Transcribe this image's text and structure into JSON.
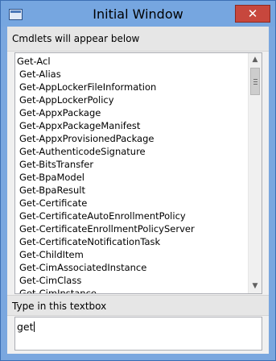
{
  "window": {
    "title": "Initial Window",
    "close_glyph": "✕",
    "icon": "app-window-icon"
  },
  "list_section": {
    "label": "Cmdlets will appear below",
    "items": [
      "Get-Acl",
      "Get-Alias",
      "Get-AppLockerFileInformation",
      "Get-AppLockerPolicy",
      "Get-AppxPackage",
      "Get-AppxPackageManifest",
      "Get-AppxProvisionedPackage",
      "Get-AuthenticodeSignature",
      "Get-BitsTransfer",
      "Get-BpaModel",
      "Get-BpaResult",
      "Get-Certificate",
      "Get-CertificateAutoEnrollmentPolicy",
      "Get-CertificateEnrollmentPolicyServer",
      "Get-CertificateNotificationTask",
      "Get-ChildItem",
      "Get-CimAssociatedInstance",
      "Get-CimClass",
      "Get-CimInstance"
    ]
  },
  "input_section": {
    "label": "Type in this textbox",
    "value": "get"
  },
  "colors": {
    "titlebar": "#76a6e0",
    "close_button": "#c7473d",
    "panel": "#f0f0f0"
  }
}
